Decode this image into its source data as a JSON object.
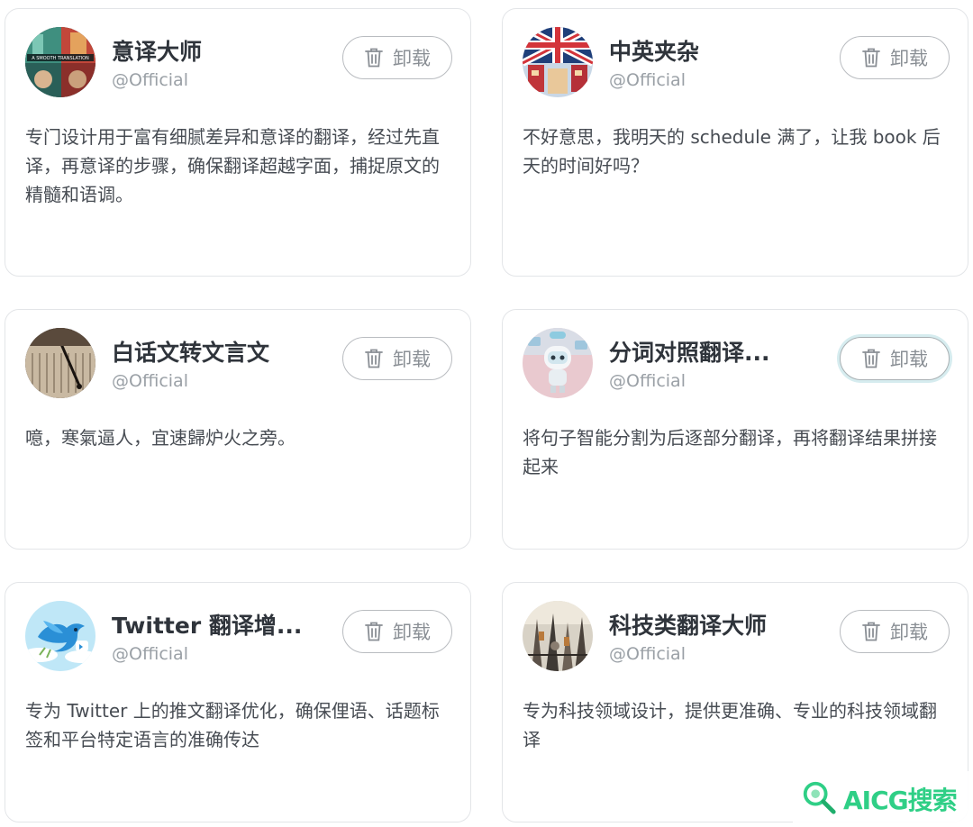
{
  "cards": [
    {
      "title": "意译大师",
      "author": "@Official",
      "button_label": "卸载",
      "description": "专门设计用于富有细腻差异和意译的翻译，经过先直译，再意译的步骤，确保翻译超越字面，捕捉原文的精髓和语调。",
      "avatar_text": "A SMOOTH TRANSLATION"
    },
    {
      "title": "中英夹杂",
      "author": "@Official",
      "button_label": "卸载",
      "description": "不好意思，我明天的 schedule 满了，让我 book 后天的时间好吗？"
    },
    {
      "title": "白话文转文言文",
      "author": "@Official",
      "button_label": "卸载",
      "description": "噫，寒氣逼人，宜速歸炉火之旁。"
    },
    {
      "title": "分词对照翻译...",
      "author": "@Official",
      "button_label": "卸载",
      "description": "将句子智能分割为后逐部分翻译，再将翻译结果拼接起来"
    },
    {
      "title": "Twitter 翻译增...",
      "author": "@Official",
      "button_label": "卸载",
      "description": "专为 Twitter 上的推文翻译优化，确保俚语、话题标签和平台特定语言的准确传达"
    },
    {
      "title": "科技类翻译大师",
      "author": "@Official",
      "button_label": "卸载",
      "description": "专为科技领域设计，提供更准确、专业的科技领域翻译"
    }
  ],
  "watermark": "AICG搜索",
  "colors": {
    "card_border": "#e3e5e8",
    "title": "#2f343b",
    "author": "#9aa0a6",
    "button_border": "#b9bcc0",
    "watermark": "#2fcf86"
  }
}
